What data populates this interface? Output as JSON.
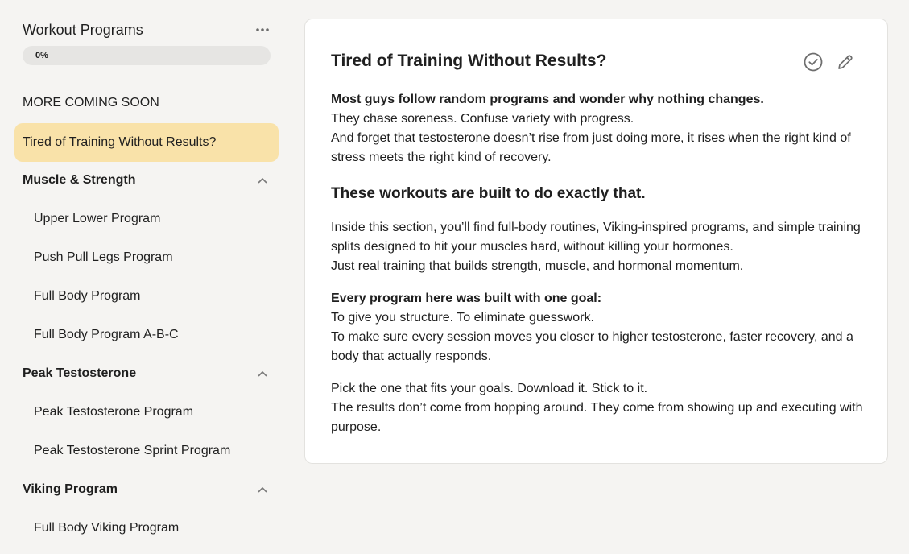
{
  "sidebar": {
    "course_title": "Workout Programs",
    "more_icon": "more-horizontal-icon",
    "progress": {
      "value": 0,
      "label": "0%"
    },
    "section_label": "MORE COMING SOON",
    "active_lesson": "Tired of Training Without Results?",
    "groups": [
      {
        "title": "Muscle & Strength",
        "icon": "chevron-up-icon",
        "lessons": [
          "Upper Lower Program",
          "Push Pull Legs Program",
          "Full Body Program",
          "Full Body Program A-B-C"
        ]
      },
      {
        "title": "Peak Testosterone",
        "icon": "chevron-up-icon",
        "lessons": [
          "Peak Testosterone Program",
          "Peak Testosterone Sprint Program"
        ]
      },
      {
        "title": "Viking Program",
        "icon": "chevron-up-icon",
        "lessons": [
          "Full Body Viking Program"
        ]
      }
    ]
  },
  "content": {
    "title": "Tired of Training Without Results?",
    "complete_icon": "check-circle-icon",
    "edit_icon": "pencil-icon",
    "p1": {
      "bold": "Most guys follow random programs and wonder why nothing changes.",
      "line2": "They chase soreness. Confuse variety with progress.",
      "line3": "And forget that testosterone doesn’t rise from just doing more, it rises when the right kind of stress meets the right kind of recovery."
    },
    "subheading": "These workouts are built to do exactly that.",
    "p2": {
      "line1": "Inside this section, you’ll find full-body routines, Viking-inspired programs, and simple training splits designed to hit your muscles hard, without killing your hormones.",
      "line2": "Just real training that builds strength, muscle, and hormonal momentum."
    },
    "p3": {
      "bold": "Every program here was built with one goal:",
      "line2": "To give you structure. To eliminate guesswork.",
      "line3": "To make sure every session moves you closer to higher testosterone, faster recovery, and a body that actually responds."
    },
    "p4": {
      "line1": "Pick the one that fits your goals. Download it. Stick to it.",
      "line2": "The results don’t come from hopping around. They come from showing up and executing with purpose."
    }
  }
}
